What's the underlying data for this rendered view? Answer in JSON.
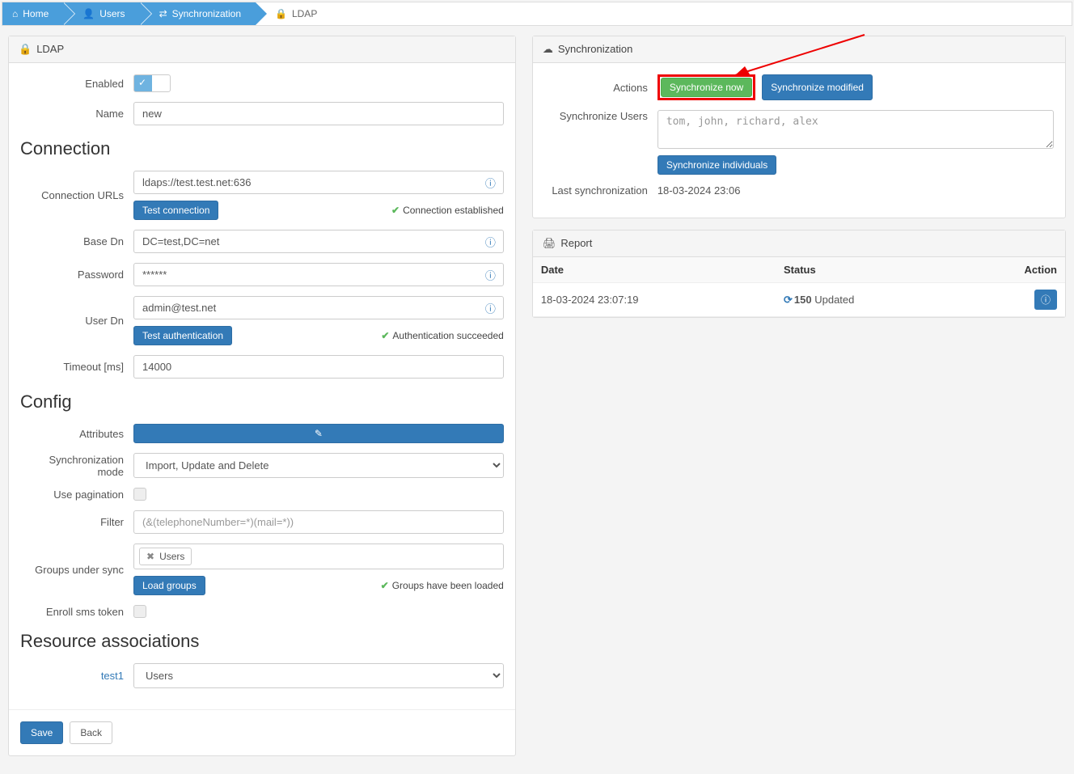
{
  "breadcrumb": [
    {
      "label": "Home",
      "icon": "🏠"
    },
    {
      "label": "Users",
      "icon": "👤"
    },
    {
      "label": "Synchronization",
      "icon": "🔀"
    },
    {
      "label": "LDAP",
      "icon": "🔒"
    }
  ],
  "ldapPanel": {
    "title": "LDAP",
    "enabledLabel": "Enabled",
    "nameLabel": "Name",
    "nameValue": "new",
    "connectionHeader": "Connection",
    "connUrlsLabel": "Connection URLs",
    "connUrlsValue": "ldaps://test.test.net:636",
    "testConnBtn": "Test connection",
    "connEstablished": "Connection established",
    "baseDnLabel": "Base Dn",
    "baseDnValue": "DC=test,DC=net",
    "passwordLabel": "Password",
    "passwordValue": "******",
    "userDnLabel": "User Dn",
    "userDnValue": "admin@test.net",
    "testAuthBtn": "Test authentication",
    "authSuccess": "Authentication succeeded",
    "timeoutLabel": "Timeout [ms]",
    "timeoutValue": "14000",
    "configHeader": "Config",
    "attributesLabel": "Attributes",
    "syncModeLabel": "Synchronization mode",
    "syncModeValue": "Import, Update and Delete",
    "usePaginationLabel": "Use pagination",
    "filterLabel": "Filter",
    "filterPlaceholder": "(&(telephoneNumber=*)(mail=*))",
    "groupsLabel": "Groups under sync",
    "groupTag": "Users",
    "loadGroupsBtn": "Load groups",
    "groupsLoaded": "Groups have been loaded",
    "enrollSmsLabel": "Enroll sms token",
    "resourceHeader": "Resource associations",
    "resourceLink": "test1",
    "resourceValue": "Users",
    "saveBtn": "Save",
    "backBtn": "Back"
  },
  "syncPanel": {
    "title": "Synchronization",
    "actionsLabel": "Actions",
    "syncNowBtn": "Synchronize now",
    "syncModifiedBtn": "Synchronize modified",
    "syncUsersLabel": "Synchronize Users",
    "syncUsersPlaceholder": "tom, john, richard, alex",
    "syncIndividualsBtn": "Synchronize individuals",
    "lastSyncLabel": "Last synchronization",
    "lastSyncValue": "18-03-2024 23:06"
  },
  "reportPanel": {
    "title": "Report",
    "headers": {
      "date": "Date",
      "status": "Status",
      "action": "Action"
    },
    "row": {
      "date": "18-03-2024 23:07:19",
      "count": "150",
      "statusText": " Updated"
    }
  }
}
